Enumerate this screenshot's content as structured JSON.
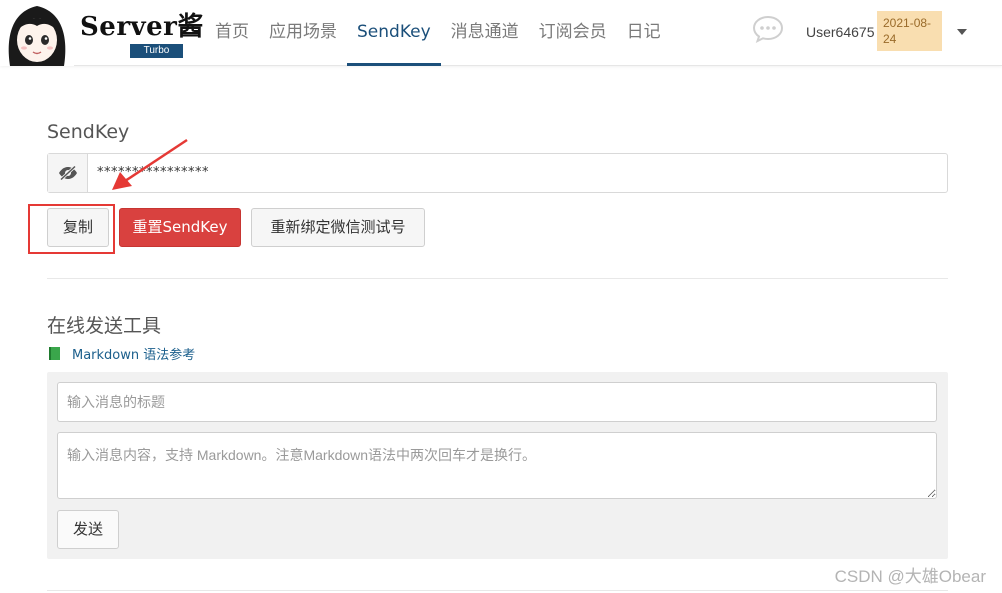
{
  "header": {
    "brand_name": "Server酱",
    "brand_badge": "Turbo",
    "nav": [
      {
        "label": "首页"
      },
      {
        "label": "应用场景"
      },
      {
        "label": "SendKey"
      },
      {
        "label": "消息通道"
      },
      {
        "label": "订阅会员"
      },
      {
        "label": "日记"
      }
    ],
    "active_nav": "SendKey",
    "username": "User64675",
    "date_badge": "2021-08-24"
  },
  "sendkey": {
    "label": "SendKey",
    "masked_value": "****************",
    "copy_label": "复制",
    "reset_label": "重置SendKey",
    "rebind_label": "重新绑定微信测试号"
  },
  "tool": {
    "title": "在线发送工具",
    "markdown_link": "Markdown 语法参考",
    "title_placeholder": "输入消息的标题",
    "content_placeholder": "输入消息内容，支持 Markdown。注意Markdown语法中两次回车才是换行。",
    "send_label": "发送"
  },
  "watermark": "CSDN @大雄Obear",
  "colors": {
    "brand_blue": "#1b4f7a",
    "danger_red": "#d9413f",
    "badge_bg": "#f9deb0",
    "annotation_red": "#e53935"
  },
  "icons": {
    "eye": "eye-slash-icon",
    "chat": "chat-bubble-icon",
    "book": "book-icon",
    "caret": "chevron-down-icon"
  }
}
